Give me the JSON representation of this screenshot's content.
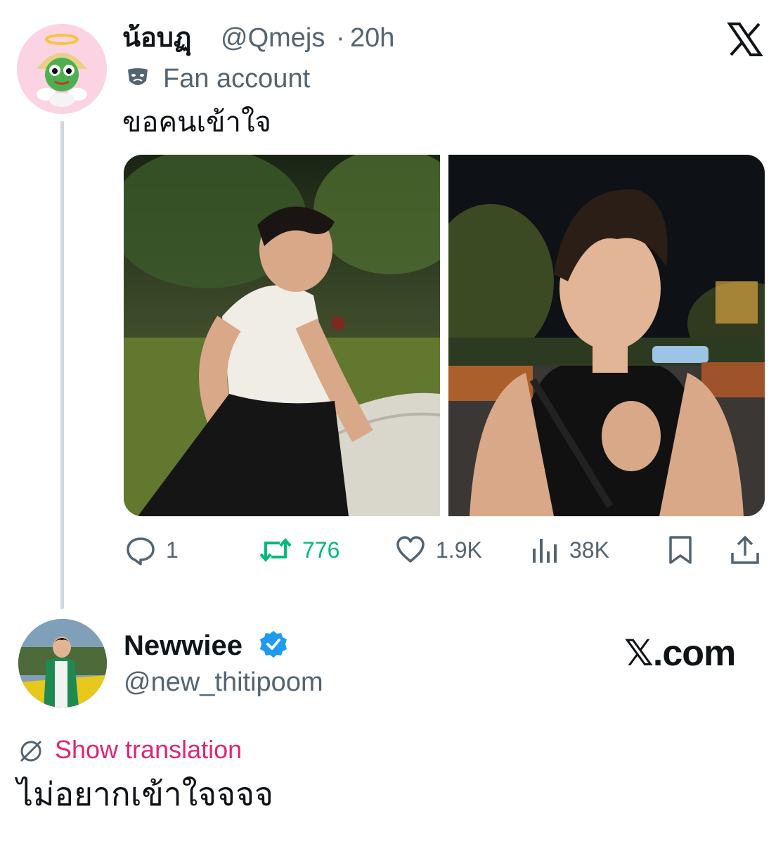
{
  "quoted_tweet": {
    "display_name": "น้อบฏฺ",
    "handle": "@Qmejs",
    "separator": "·",
    "time": "20h",
    "label": "Fan account",
    "text": "ขอคนเข้าใจ",
    "stats": {
      "replies": "1",
      "reposts": "776",
      "likes": "1.9K",
      "views": "38K"
    }
  },
  "reply_tweet": {
    "display_name": "Newwiee",
    "handle": "@new_thitipoom",
    "translate_label": "Show translation",
    "text": "ไม่อยากเข้าใจจจจ"
  },
  "watermark": "𝕏.com",
  "colors": {
    "text_primary": "#0f1419",
    "text_secondary": "#536471",
    "repost_green": "#00ba7c",
    "verified_blue": "#1d9bf0",
    "translate_pink": "#e0247a"
  }
}
